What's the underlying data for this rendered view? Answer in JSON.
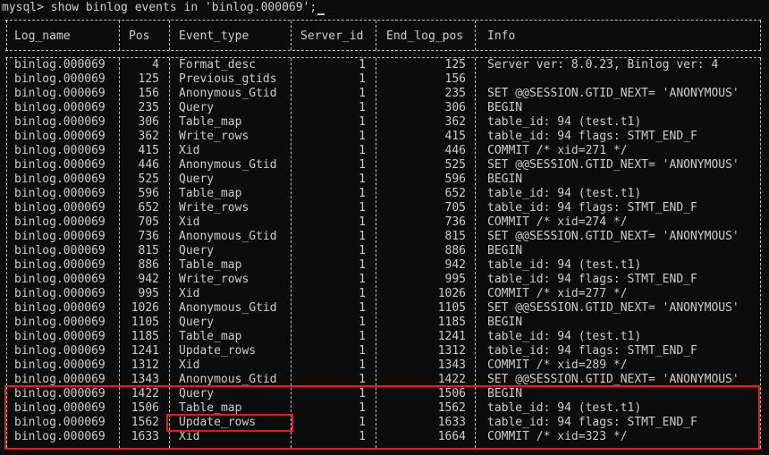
{
  "window": {
    "prompt_text": "mysql> show binlog events in 'binlog.000069';"
  },
  "table": {
    "headers": [
      "Log_name",
      "Pos",
      "Event_type",
      "Server_id",
      "End_log_pos",
      "Info"
    ],
    "rows": [
      [
        "binlog.000069",
        "4",
        "Format_desc",
        "1",
        "125",
        "Server ver: 8.0.23, Binlog ver: 4"
      ],
      [
        "binlog.000069",
        "125",
        "Previous_gtids",
        "1",
        "156",
        ""
      ],
      [
        "binlog.000069",
        "156",
        "Anonymous_Gtid",
        "1",
        "235",
        "SET @@SESSION.GTID_NEXT= 'ANONYMOUS'"
      ],
      [
        "binlog.000069",
        "235",
        "Query",
        "1",
        "306",
        "BEGIN"
      ],
      [
        "binlog.000069",
        "306",
        "Table_map",
        "1",
        "362",
        "table_id: 94 (test.t1)"
      ],
      [
        "binlog.000069",
        "362",
        "Write_rows",
        "1",
        "415",
        "table_id: 94 flags: STMT_END_F"
      ],
      [
        "binlog.000069",
        "415",
        "Xid",
        "1",
        "446",
        "COMMIT /* xid=271 */"
      ],
      [
        "binlog.000069",
        "446",
        "Anonymous_Gtid",
        "1",
        "525",
        "SET @@SESSION.GTID_NEXT= 'ANONYMOUS'"
      ],
      [
        "binlog.000069",
        "525",
        "Query",
        "1",
        "596",
        "BEGIN"
      ],
      [
        "binlog.000069",
        "596",
        "Table_map",
        "1",
        "652",
        "table_id: 94 (test.t1)"
      ],
      [
        "binlog.000069",
        "652",
        "Write_rows",
        "1",
        "705",
        "table_id: 94 flags: STMT_END_F"
      ],
      [
        "binlog.000069",
        "705",
        "Xid",
        "1",
        "736",
        "COMMIT /* xid=274 */"
      ],
      [
        "binlog.000069",
        "736",
        "Anonymous_Gtid",
        "1",
        "815",
        "SET @@SESSION.GTID_NEXT= 'ANONYMOUS'"
      ],
      [
        "binlog.000069",
        "815",
        "Query",
        "1",
        "886",
        "BEGIN"
      ],
      [
        "binlog.000069",
        "886",
        "Table_map",
        "1",
        "942",
        "table_id: 94 (test.t1)"
      ],
      [
        "binlog.000069",
        "942",
        "Write_rows",
        "1",
        "995",
        "table_id: 94 flags: STMT_END_F"
      ],
      [
        "binlog.000069",
        "995",
        "Xid",
        "1",
        "1026",
        "COMMIT /* xid=277 */"
      ],
      [
        "binlog.000069",
        "1026",
        "Anonymous_Gtid",
        "1",
        "1105",
        "SET @@SESSION.GTID_NEXT= 'ANONYMOUS'"
      ],
      [
        "binlog.000069",
        "1105",
        "Query",
        "1",
        "1185",
        "BEGIN"
      ],
      [
        "binlog.000069",
        "1185",
        "Table_map",
        "1",
        "1241",
        "table_id: 94 (test.t1)"
      ],
      [
        "binlog.000069",
        "1241",
        "Update_rows",
        "1",
        "1312",
        "table_id: 94 flags: STMT_END_F"
      ],
      [
        "binlog.000069",
        "1312",
        "Xid",
        "1",
        "1343",
        "COMMIT /* xid=289 */"
      ],
      [
        "binlog.000069",
        "1343",
        "Anonymous_Gtid",
        "1",
        "1422",
        "SET @@SESSION.GTID_NEXT= 'ANONYMOUS'"
      ],
      [
        "binlog.000069",
        "1422",
        "Query",
        "1",
        "1506",
        "BEGIN"
      ],
      [
        "binlog.000069",
        "1506",
        "Table_map",
        "1",
        "1562",
        "table_id: 94 (test.t1)"
      ],
      [
        "binlog.000069",
        "1562",
        "Update_rows",
        "1",
        "1633",
        "table_id: 94 flags: STMT_END_F"
      ],
      [
        "binlog.000069",
        "1633",
        "Xid",
        "1",
        "1664",
        "COMMIT /* xid=323 */"
      ]
    ]
  },
  "annotations": {
    "highlight_color": "#e02020"
  }
}
